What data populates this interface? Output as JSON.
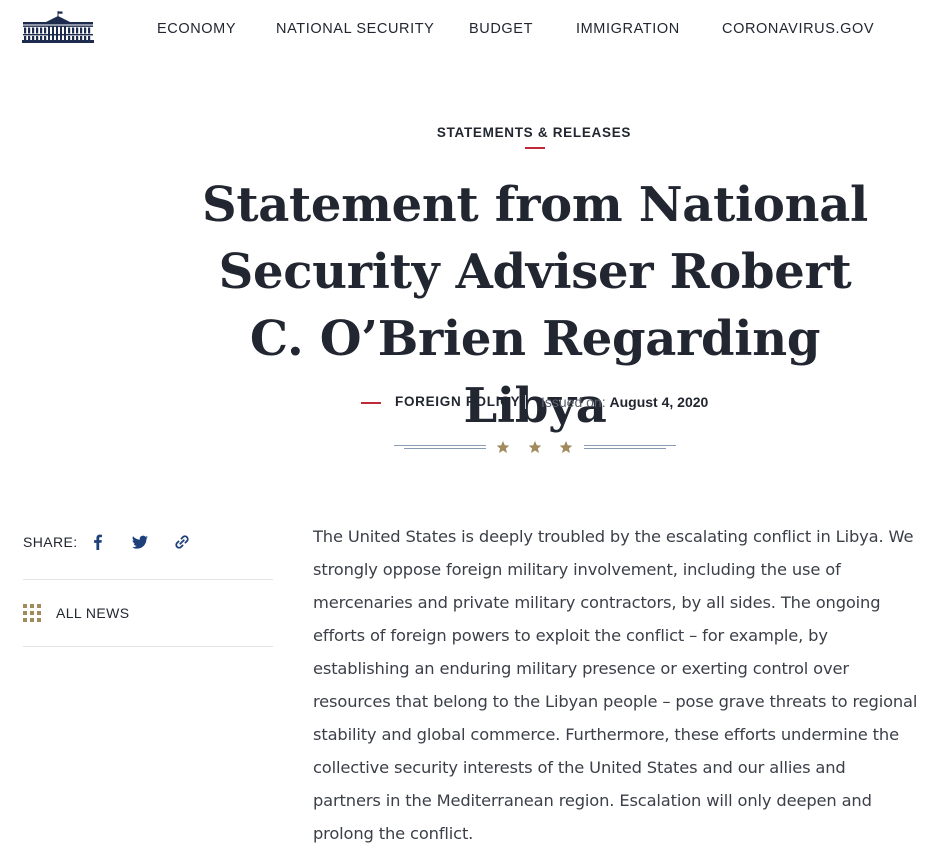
{
  "header": {
    "nav": [
      {
        "label": "ECONOMY"
      },
      {
        "label": "NATIONAL SECURITY"
      },
      {
        "label": "BUDGET"
      },
      {
        "label": "IMMIGRATION"
      },
      {
        "label": "CORONAVIRUS.GOV"
      }
    ]
  },
  "article": {
    "kicker": "STATEMENTS & RELEASES",
    "title": "Statement from National Security Adviser Robert C. O’Brien Regarding Libya",
    "category": "FOREIGN POLICY",
    "issued_label": "Issued on:",
    "issued_date": "August 4, 2020",
    "body": "The United States is deeply troubled by the escalating conflict in Libya. We strongly oppose foreign military involvement, including the use of mercenaries and private military contractors, by all sides.  The ongoing efforts of foreign powers to exploit the conflict – for example, by establishing an enduring military presence or exerting control over resources that belong to the Libyan people – pose grave threats to regional stability and global commerce.  Furthermore, these efforts undermine the collective security interests of the United States and our allies and partners in the Mediterranean region.  Escalation will only deepen and prolong the conflict."
  },
  "sidebar": {
    "share_label": "SHARE:",
    "share_icons": [
      "facebook-icon",
      "twitter-icon",
      "link-icon"
    ],
    "all_news_label": "ALL NEWS"
  },
  "colors": {
    "text": "#212631",
    "accent_red": "#c0293a",
    "gold": "#a08a5e",
    "logo_navy": "#1d2b4f",
    "share_blue": "#1d3f7a"
  }
}
